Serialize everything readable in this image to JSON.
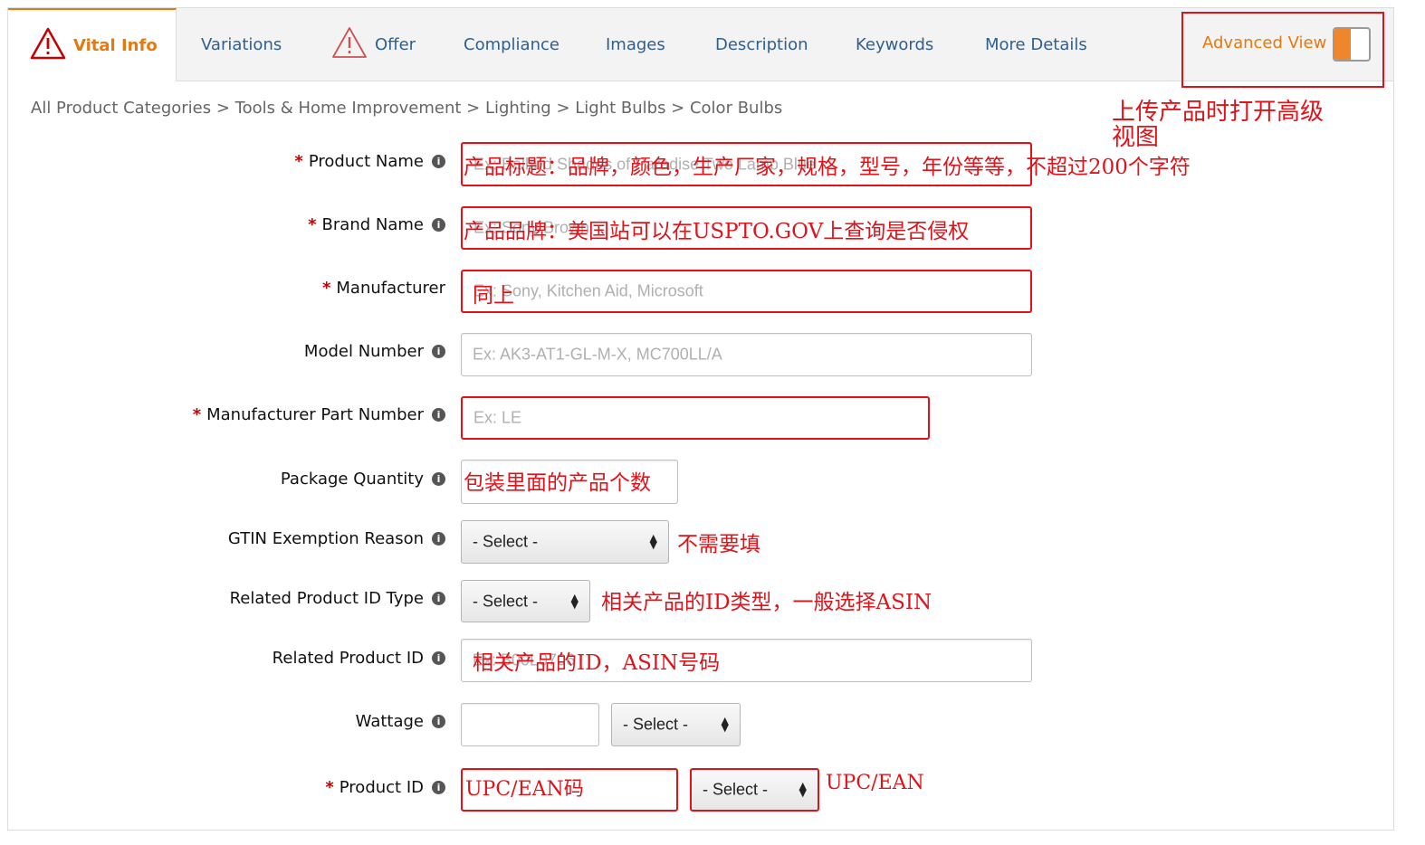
{
  "tabs": {
    "vital_info": "Vital Info",
    "variations": "Variations",
    "offer": "Offer",
    "compliance": "Compliance",
    "images": "Images",
    "description": "Description",
    "keywords": "Keywords",
    "more_details": "More Details",
    "advanced_view": "Advanced View"
  },
  "breadcrumb": "All Product Categories > Tools & Home Improvement > Lighting > Light Bulbs > Color Bulbs",
  "info_glyph": "i",
  "required_mark": "*",
  "fields": {
    "product_name": {
      "label": "Product Name",
      "placeholder": "Ex: Ballard Shades of Paradise Two Lamp Blue"
    },
    "brand_name": {
      "label": "Brand Name",
      "placeholder": "Ex: Sony Brown"
    },
    "manufacturer": {
      "label": "Manufacturer",
      "placeholder": "Ex: Sony, Kitchen Aid, Microsoft"
    },
    "model_number": {
      "label": "Model Number",
      "placeholder": "Ex: AK3-AT1-GL-M-X, MC700LL/A"
    },
    "mpn": {
      "label": "Manufacturer Part Number",
      "placeholder": "Ex: LE"
    },
    "package_quantity": {
      "label": "Package Quantity",
      "placeholder": ""
    },
    "gtin_exemption": {
      "label": "GTIN Exemption Reason",
      "value": "- Select -"
    },
    "related_id_type": {
      "label": "Related Product ID Type",
      "value": "- Select -"
    },
    "related_id": {
      "label": "Related Product ID",
      "placeholder": "Ex: B00L0706"
    },
    "wattage": {
      "label": "Wattage",
      "unit_value": "- Select -"
    },
    "product_id": {
      "label": "Product ID",
      "type_value": "- Select -"
    }
  },
  "annotations": {
    "advanced_view": "上传产品时打开高级",
    "advanced_view_2": "视图",
    "product_name": "产品标题：品牌，颜色，生产厂家，规格，型号，年份等等，不超过200个字符",
    "brand_name": "产品品牌：美国站可以在USPTO.GOV上查询是否侵权",
    "manufacturer": "同上",
    "package_quantity": "包装里面的产品个数",
    "gtin_exemption": "不需要填",
    "related_id_type": "相关产品的ID类型，一般选择ASIN",
    "related_id": "相关产品的ID，ASIN号码",
    "product_id": "UPC/EAN码",
    "product_id_type": "UPC/EAN"
  },
  "colors": {
    "accent": "#e47911",
    "link": "#2f5f8f",
    "annotation_red": "#e0131a"
  }
}
